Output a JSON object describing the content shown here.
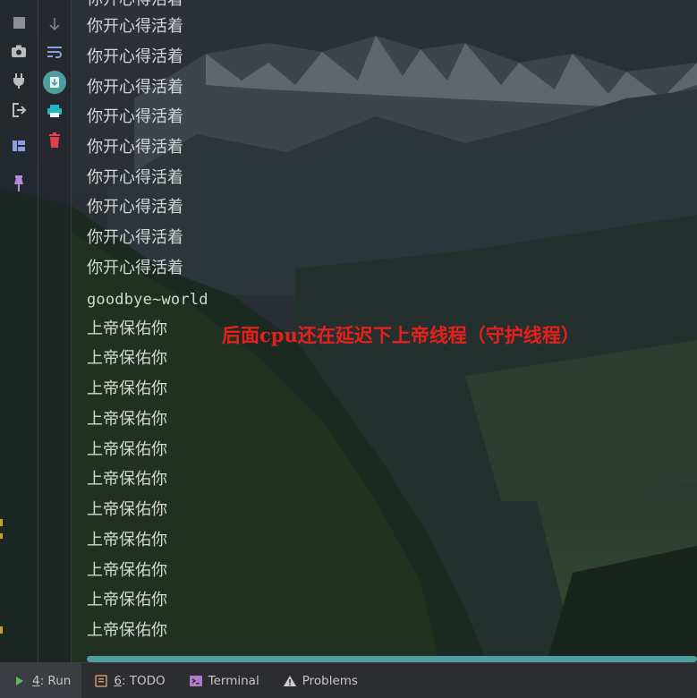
{
  "console": {
    "lines_top": [
      "你开心得活着",
      "你开心得活着",
      "你开心得活着",
      "你开心得活着",
      "你开心得活着",
      "你开心得活着",
      "你开心得活着",
      "你开心得活着",
      "你开心得活着",
      "你开心得活着"
    ],
    "goodbye": "goodbye~world",
    "lines_bottom": [
      "上帝保佑你",
      "上帝保佑你",
      "上帝保佑你",
      "上帝保佑你",
      "上帝保佑你",
      "上帝保佑你",
      "上帝保佑你",
      "上帝保佑你",
      "上帝保佑你",
      "上帝保佑你",
      "上帝保佑你"
    ]
  },
  "annotation": "后面cpu还在延迟下上帝线程（守护线程）",
  "bottom_tabs": [
    {
      "prefix": "4",
      "label": ": Run",
      "icon": "run-icon"
    },
    {
      "prefix": "6",
      "label": ": TODO",
      "icon": "todo-icon"
    },
    {
      "prefix": "",
      "label": "Terminal",
      "icon": "terminal-icon"
    },
    {
      "prefix": "",
      "label": "Problems",
      "icon": "warning-icon"
    }
  ],
  "colors": {
    "annotation": "#e8201c",
    "console_text": "#d6d6d6",
    "scrollbar": "#4f9fa0",
    "scroll_to_end_button": "#4f9fa0",
    "print_icon": "#1fb8c4",
    "delete_icon": "#e0404a",
    "layout_icon": "#8a9fe0",
    "pin_icon": "#b58ad8"
  }
}
